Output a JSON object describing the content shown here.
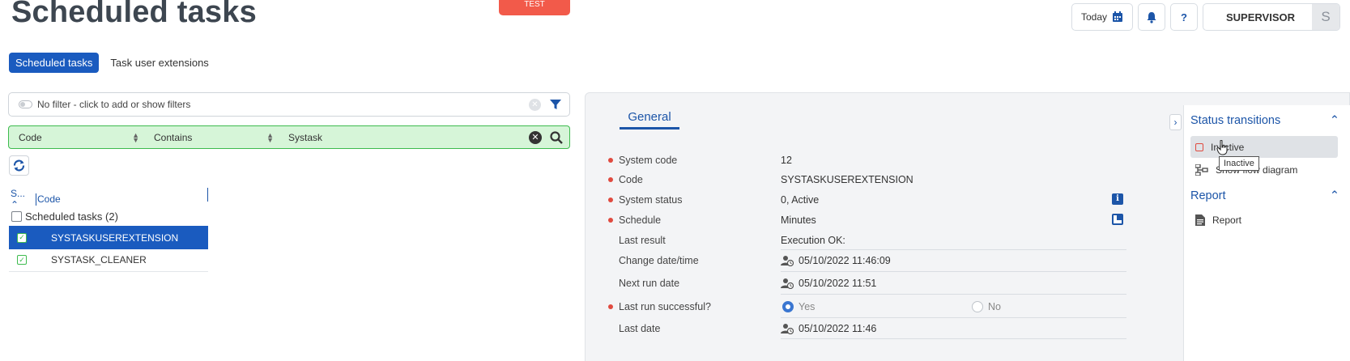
{
  "header": {
    "title": "Scheduled tasks",
    "env_badge": "TEST",
    "today_label": "Today",
    "user_name": "SUPERVISOR",
    "user_initial": "S",
    "help_label": "?"
  },
  "tabs": [
    {
      "label": "Scheduled tasks",
      "active": true
    },
    {
      "label": "Task user extensions",
      "active": false
    }
  ],
  "filter": {
    "placeholder": "No filter - click to add or show filters",
    "row": {
      "field": "Code",
      "operator": "Contains",
      "value": "Systask"
    }
  },
  "list": {
    "columns": [
      "S...",
      "Code"
    ],
    "group_label": "Scheduled tasks (2)",
    "rows": [
      {
        "code": "SYSTASKUSEREXTENSION",
        "selected": true
      },
      {
        "code": "SYSTASK_CLEANER",
        "selected": false
      }
    ]
  },
  "detail": {
    "tab": "General",
    "fields": {
      "system_code": {
        "label": "System code",
        "value": "12"
      },
      "code": {
        "label": "Code",
        "value": "SYSTASKUSEREXTENSION"
      },
      "system_status": {
        "label": "System status",
        "value": "0, Active"
      },
      "schedule": {
        "label": "Schedule",
        "value": "Minutes"
      },
      "last_result": {
        "label": "Last result",
        "value": "Execution OK:"
      },
      "change_date": {
        "label": "Change date/time",
        "value": "05/10/2022 11:46:09"
      },
      "next_run": {
        "label": "Next run date",
        "value": "05/10/2022 11:51"
      },
      "last_run_successful": {
        "label": "Last run successful?",
        "yes": "Yes",
        "no": "No",
        "selected": "Yes"
      },
      "last_date": {
        "label": "Last date",
        "value": "05/10/2022 11:46"
      }
    }
  },
  "side_panel": {
    "status_transitions": {
      "title": "Status transitions",
      "items": [
        "Inactive",
        "Show flow diagram"
      ]
    },
    "report": {
      "title": "Report",
      "items": [
        "Report"
      ]
    },
    "tooltip": "Inactive"
  },
  "colors": {
    "primary": "#1a5bbf",
    "accent_link": "#1c55a8",
    "badge": "#f25a4a",
    "filter_green_bg": "#d6f5d8",
    "filter_green_border": "#3dbb4e",
    "required_dot": "#e04a3f"
  }
}
